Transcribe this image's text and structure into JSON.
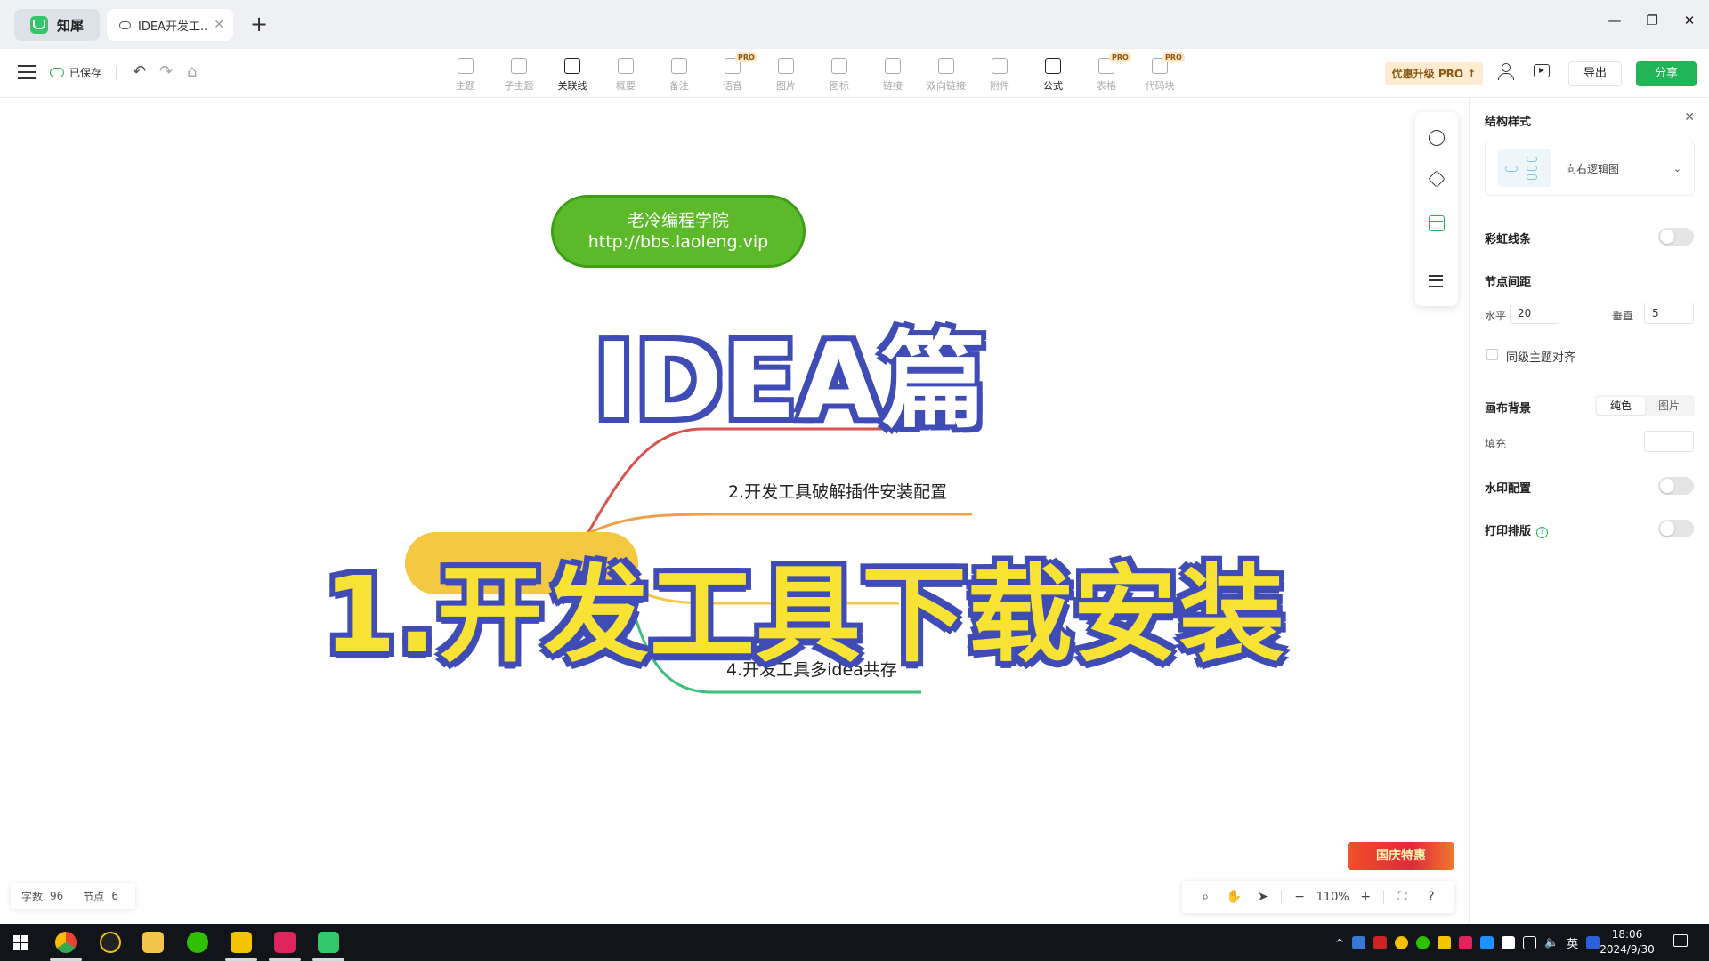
{
  "titlebar": {
    "app_name": "知犀",
    "doc_tab_title": "IDEA开发工...",
    "new_tab": "+",
    "window_controls": [
      "—",
      "❐",
      "✕"
    ]
  },
  "toolbar": {
    "save_status": "已保存",
    "tools": [
      {
        "label": "主题",
        "icon": "topic-icon",
        "active": false,
        "pro": false
      },
      {
        "label": "子主题",
        "icon": "subtopic-icon",
        "active": false,
        "pro": false
      },
      {
        "label": "关联线",
        "icon": "relation-line-icon",
        "active": true,
        "pro": false
      },
      {
        "label": "概要",
        "icon": "summary-icon",
        "active": false,
        "pro": false
      },
      {
        "label": "备注",
        "icon": "note-icon",
        "active": false,
        "pro": false
      },
      {
        "label": "语音",
        "icon": "voice-icon",
        "active": false,
        "pro": true
      },
      {
        "label": "图片",
        "icon": "image-icon",
        "active": false,
        "pro": false
      },
      {
        "label": "图标",
        "icon": "emoji-icon",
        "active": false,
        "pro": false
      },
      {
        "label": "链接",
        "icon": "link-icon",
        "active": false,
        "pro": false
      },
      {
        "label": "双向链接",
        "icon": "bilink-icon",
        "active": false,
        "pro": false
      },
      {
        "label": "附件",
        "icon": "attachment-icon",
        "active": false,
        "pro": false
      },
      {
        "label": "公式",
        "icon": "formula-icon",
        "active": true,
        "pro": false
      },
      {
        "label": "表格",
        "icon": "table-icon",
        "active": false,
        "pro": true
      },
      {
        "label": "代码块",
        "icon": "code-block-icon",
        "active": false,
        "pro": true
      }
    ],
    "pro_badge": "PRO",
    "upgrade_label": "优惠升级 PRO ↑",
    "export_label": "导出",
    "share_label": "分享"
  },
  "canvas": {
    "brand_line1": "老冷编程学院",
    "brand_line2": "http://bbs.laoleng.vip",
    "nodes": [
      "2.开发工具破解插件安装配置",
      "4.开发工具多idea共存"
    ],
    "overlay_title_1": "IDEA篇",
    "overlay_title_2": "1.开发工具下载安装",
    "branch_colors": [
      "#d9534f",
      "#f0a04b",
      "#f5c842",
      "#3dbf7a"
    ],
    "promo": "国庆特惠",
    "stats": {
      "word_label": "字数",
      "word_count": "96",
      "node_label": "节点",
      "node_count": "6"
    },
    "zoom": "110%"
  },
  "panel": {
    "title": "结构样式",
    "structure_name": "向右逻辑图",
    "rainbow_label": "彩虹线条",
    "spacing_label": "节点间距",
    "horizontal_label": "水平",
    "horizontal_value": "20",
    "vertical_label": "垂直",
    "vertical_value": "5",
    "align_label": "同级主题对齐",
    "bg_label": "画布背景",
    "bg_options": [
      "纯色",
      "图片"
    ],
    "fill_label": "填充",
    "watermark_label": "水印配置",
    "print_label": "打印排版"
  },
  "taskbar": {
    "ime": "英",
    "time": "18:06",
    "date": "2024/9/30"
  }
}
